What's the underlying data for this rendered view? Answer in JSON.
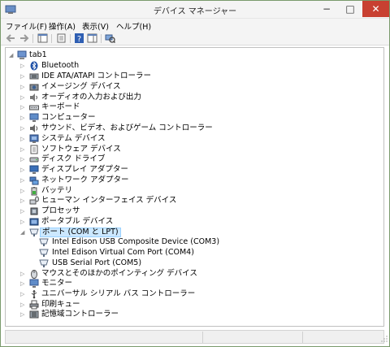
{
  "window": {
    "title": "デバイス マネージャー"
  },
  "titlebar_controls": {
    "minimize": "−",
    "maximize": "□",
    "close": "✕"
  },
  "menu": [
    "ファイル(F)",
    "操作(A)",
    "表示(V)",
    "ヘルプ(H)"
  ],
  "toolbar_icons": [
    "back-arrow-icon",
    "forward-arrow-icon",
    "show-hide-tree-icon",
    "properties-icon",
    "help-icon",
    "action-pane-icon",
    "scan-hardware-icon"
  ],
  "tree": {
    "root": "tab1",
    "categories": [
      "Bluetooth",
      "IDE ATA/ATAPI コントローラー",
      "イメージング デバイス",
      "オーディオの入力および出力",
      "キーボード",
      "コンピューター",
      "サウンド、ビデオ、およびゲーム コントローラー",
      "システム デバイス",
      "ソフトウェア デバイス",
      "ディスク ドライブ",
      "ディスプレイ アダプター",
      "ネットワーク アダプター",
      "バッテリ",
      "ヒューマン インターフェイス デバイス",
      "プロセッサ",
      "ポータブル デバイス",
      "ポート (COM と LPT)",
      "マウスとそのほかのポインティング デバイス",
      "モニター",
      "ユニバーサル シリアル バス コントローラー",
      "印刷キュー",
      "記憶域コントローラー"
    ],
    "ports_children": [
      "Intel Edison USB Composite Device (COM3)",
      "Intel Edison Virtual Com Port (COM4)",
      "USB Serial Port (COM5)"
    ],
    "expand_collapsed": "▷",
    "expand_open": "◢"
  },
  "colors": {
    "selection": "#cce8ff",
    "selection_border": "#99d1ff",
    "close_button": "#c84031"
  }
}
